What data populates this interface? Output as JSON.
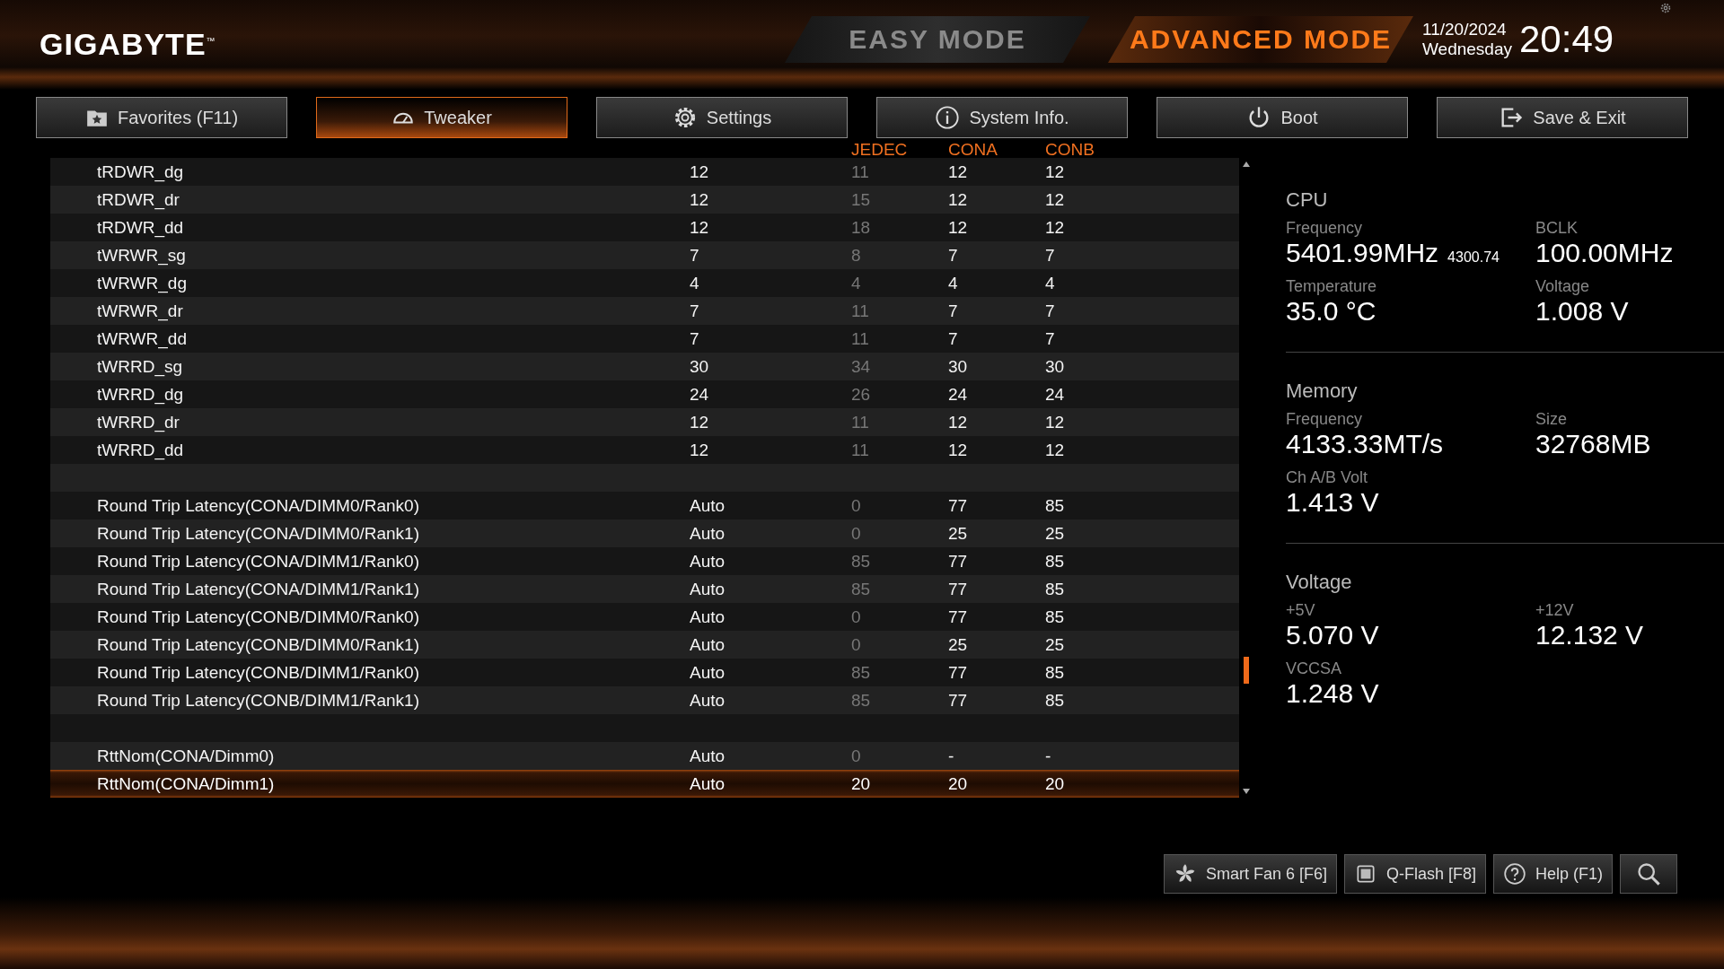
{
  "brand": "GIGABYTE",
  "brand_mark": "™",
  "modes": [
    {
      "label": "EASY MODE",
      "selected": false
    },
    {
      "label": "ADVANCED MODE",
      "selected": true
    }
  ],
  "date": "11/20/2024",
  "weekday": "Wednesday",
  "time": "20:49",
  "tabs": [
    {
      "label": "Favorites (F11)",
      "selected": false
    },
    {
      "label": "Tweaker",
      "selected": true
    },
    {
      "label": "Settings",
      "selected": false
    },
    {
      "label": "System Info.",
      "selected": false
    },
    {
      "label": "Boot",
      "selected": false
    },
    {
      "label": "Save & Exit",
      "selected": false
    }
  ],
  "table": {
    "columns": [
      "JEDEC",
      "CONA",
      "CONB"
    ],
    "rows": [
      {
        "kind": "setting",
        "name": "tRDWR_dg",
        "value": "12",
        "jedec": "11",
        "cona": "12",
        "conb": "12",
        "selected": false
      },
      {
        "kind": "setting",
        "name": "tRDWR_dr",
        "value": "12",
        "jedec": "15",
        "cona": "12",
        "conb": "12",
        "selected": false
      },
      {
        "kind": "setting",
        "name": "tRDWR_dd",
        "value": "12",
        "jedec": "18",
        "cona": "12",
        "conb": "12",
        "selected": false
      },
      {
        "kind": "setting",
        "name": "tWRWR_sg",
        "value": "7",
        "jedec": "8",
        "cona": "7",
        "conb": "7",
        "selected": false
      },
      {
        "kind": "setting",
        "name": "tWRWR_dg",
        "value": "4",
        "jedec": "4",
        "cona": "4",
        "conb": "4",
        "selected": false
      },
      {
        "kind": "setting",
        "name": "tWRWR_dr",
        "value": "7",
        "jedec": "11",
        "cona": "7",
        "conb": "7",
        "selected": false
      },
      {
        "kind": "setting",
        "name": "tWRWR_dd",
        "value": "7",
        "jedec": "11",
        "cona": "7",
        "conb": "7",
        "selected": false
      },
      {
        "kind": "setting",
        "name": "tWRRD_sg",
        "value": "30",
        "jedec": "34",
        "cona": "30",
        "conb": "30",
        "selected": false
      },
      {
        "kind": "setting",
        "name": "tWRRD_dg",
        "value": "24",
        "jedec": "26",
        "cona": "24",
        "conb": "24",
        "selected": false
      },
      {
        "kind": "setting",
        "name": "tWRRD_dr",
        "value": "12",
        "jedec": "11",
        "cona": "12",
        "conb": "12",
        "selected": false
      },
      {
        "kind": "setting",
        "name": "tWRRD_dd",
        "value": "12",
        "jedec": "11",
        "cona": "12",
        "conb": "12",
        "selected": false
      },
      {
        "kind": "spacer"
      },
      {
        "kind": "setting",
        "name": "Round Trip Latency(CONA/DIMM0/Rank0)",
        "value": "Auto",
        "jedec": "0",
        "cona": "77",
        "conb": "85",
        "selected": false
      },
      {
        "kind": "setting",
        "name": "Round Trip Latency(CONA/DIMM0/Rank1)",
        "value": "Auto",
        "jedec": "0",
        "cona": "25",
        "conb": "25",
        "selected": false
      },
      {
        "kind": "setting",
        "name": "Round Trip Latency(CONA/DIMM1/Rank0)",
        "value": "Auto",
        "jedec": "85",
        "cona": "77",
        "conb": "85",
        "selected": false
      },
      {
        "kind": "setting",
        "name": "Round Trip Latency(CONA/DIMM1/Rank1)",
        "value": "Auto",
        "jedec": "85",
        "cona": "77",
        "conb": "85",
        "selected": false
      },
      {
        "kind": "setting",
        "name": "Round Trip Latency(CONB/DIMM0/Rank0)",
        "value": "Auto",
        "jedec": "0",
        "cona": "77",
        "conb": "85",
        "selected": false
      },
      {
        "kind": "setting",
        "name": "Round Trip Latency(CONB/DIMM0/Rank1)",
        "value": "Auto",
        "jedec": "0",
        "cona": "25",
        "conb": "25",
        "selected": false
      },
      {
        "kind": "setting",
        "name": "Round Trip Latency(CONB/DIMM1/Rank0)",
        "value": "Auto",
        "jedec": "85",
        "cona": "77",
        "conb": "85",
        "selected": false
      },
      {
        "kind": "setting",
        "name": "Round Trip Latency(CONB/DIMM1/Rank1)",
        "value": "Auto",
        "jedec": "85",
        "cona": "77",
        "conb": "85",
        "selected": false
      },
      {
        "kind": "spacer"
      },
      {
        "kind": "setting",
        "name": "RttNom(CONA/Dimm0)",
        "value": "Auto",
        "jedec": "0",
        "cona": "-",
        "conb": "-",
        "selected": false
      },
      {
        "kind": "setting",
        "name": "RttNom(CONA/Dimm1)",
        "value": "Auto",
        "jedec": "20",
        "cona": "20",
        "conb": "20",
        "selected": true
      }
    ]
  },
  "monitor": [
    {
      "title": "CPU",
      "items": [
        {
          "label": "Frequency",
          "value": "5401.99MHz",
          "sub": "4300.74"
        },
        {
          "label": "BCLK",
          "value": "100.00MHz"
        },
        {
          "label": "Temperature",
          "value": "35.0 °C"
        },
        {
          "label": "Voltage",
          "value": "1.008 V"
        }
      ]
    },
    {
      "title": "Memory",
      "items": [
        {
          "label": "Frequency",
          "value": "4133.33MT/s"
        },
        {
          "label": "Size",
          "value": "32768MB"
        },
        {
          "label": "Ch A/B Volt",
          "value": "1.413 V"
        }
      ]
    },
    {
      "title": "Voltage",
      "items": [
        {
          "label": "+5V",
          "value": "5.070 V"
        },
        {
          "label": "+12V",
          "value": "12.132 V"
        },
        {
          "label": "VCCSA",
          "value": "1.248 V"
        }
      ]
    }
  ],
  "bottom_buttons": [
    "Smart Fan 6 [F6]",
    "Q-Flash [F8]",
    "Help (F1)"
  ]
}
